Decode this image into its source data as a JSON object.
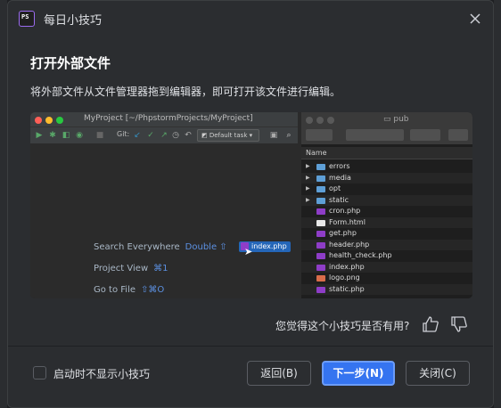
{
  "window": {
    "app_icon_text": "PS",
    "title": "每日小技巧"
  },
  "tip": {
    "heading": "打开外部文件",
    "description": "将外部文件从文件管理器拖到编辑器，即可打开该文件进行编辑。"
  },
  "illustration": {
    "ide_title": "MyProject [~/PhpstormProjects/MyProject]",
    "git_label": "Git:",
    "task_label": "Default task",
    "hints": [
      {
        "label": "Search Everywhere",
        "key": "Double ⇧"
      },
      {
        "label": "Project View",
        "key": "⌘1"
      },
      {
        "label": "Go to File",
        "key": "⇧⌘O"
      }
    ],
    "dragged_file": "index.php",
    "finder_title": "pub",
    "finder_column": "Name",
    "finder_items": [
      {
        "name": "errors",
        "type": "folder"
      },
      {
        "name": "media",
        "type": "folder"
      },
      {
        "name": "opt",
        "type": "folder"
      },
      {
        "name": "static",
        "type": "folder"
      },
      {
        "name": "cron.php",
        "type": "php"
      },
      {
        "name": "Form.html",
        "type": "html"
      },
      {
        "name": "get.php",
        "type": "php"
      },
      {
        "name": "header.php",
        "type": "php"
      },
      {
        "name": "health_check.php",
        "type": "php"
      },
      {
        "name": "index.php",
        "type": "php"
      },
      {
        "name": "logo.png",
        "type": "image"
      },
      {
        "name": "static.php",
        "type": "php"
      }
    ]
  },
  "feedback": {
    "question": "您觉得这个小技巧是否有用?"
  },
  "footer": {
    "dont_show_label": "启动时不显示小技巧",
    "dont_show_checked": false,
    "back_label": "返回(B)",
    "next_label": "下一步(N)",
    "close_label": "关闭(C)"
  },
  "colors": {
    "accent": "#3574f0",
    "dialog_bg": "#2b2d30",
    "folder": "#5e9fd6",
    "php": "#8e3dc7"
  }
}
